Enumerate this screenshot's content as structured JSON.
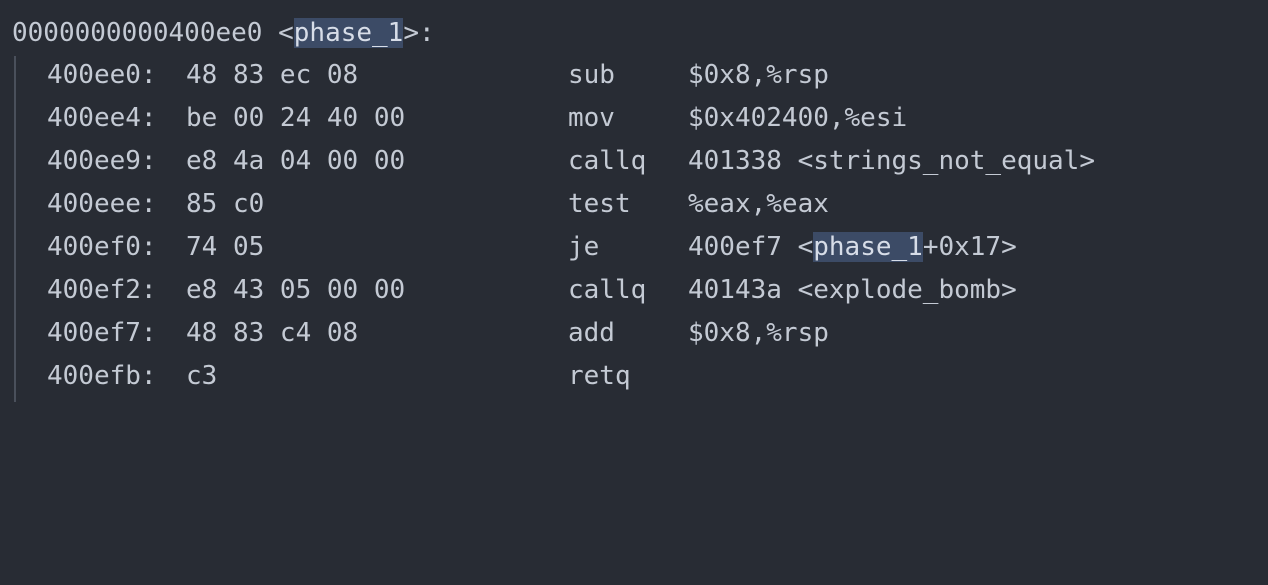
{
  "function_header": {
    "address": "0000000000400ee0",
    "open": " <",
    "name": "phase_1",
    "close": ">:"
  },
  "instructions": [
    {
      "address": "400ee0:",
      "bytes": "48 83 ec 08",
      "mnemonic": "sub",
      "operands": "$0x8,%rsp"
    },
    {
      "address": "400ee4:",
      "bytes": "be 00 24 40 00",
      "mnemonic": "mov",
      "operands": "$0x402400,%esi"
    },
    {
      "address": "400ee9:",
      "bytes": "e8 4a 04 00 00",
      "mnemonic": "callq",
      "operands": "401338 <strings_not_equal>"
    },
    {
      "address": "400eee:",
      "bytes": "85 c0",
      "mnemonic": "test",
      "operands": "%eax,%eax"
    },
    {
      "address": "400ef0:",
      "bytes": "74 05",
      "mnemonic": "je",
      "operands_pre": "400ef7 <",
      "operands_sym": "phase_1",
      "operands_post": "+0x17>"
    },
    {
      "address": "400ef2:",
      "bytes": "e8 43 05 00 00",
      "mnemonic": "callq",
      "operands": "40143a <explode_bomb>"
    },
    {
      "address": "400ef7:",
      "bytes": "48 83 c4 08",
      "mnemonic": "add",
      "operands": "$0x8,%rsp"
    },
    {
      "address": "400efb:",
      "bytes": "c3",
      "mnemonic": "retq",
      "operands": ""
    }
  ],
  "colors": {
    "background": "#282c34",
    "text": "#c4cad4",
    "highlight": "#3c4b66",
    "indent_guide": "#4a505b"
  }
}
